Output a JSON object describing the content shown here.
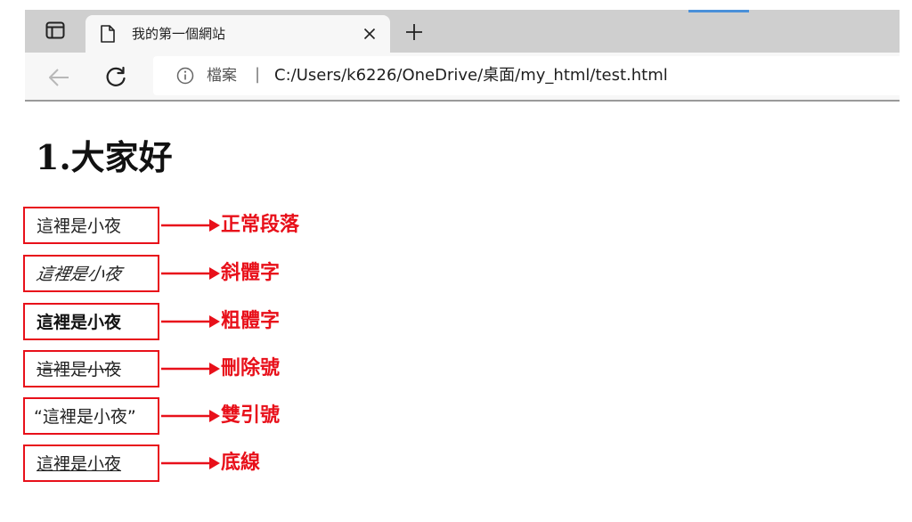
{
  "browser": {
    "tab": {
      "title": "我的第一個網站"
    },
    "address": {
      "site_label": "檔案",
      "divider": "|",
      "url": "C:/Users/k6226/OneDrive/桌面/my_html/test.html"
    },
    "icons": [
      "tab-actions-icon",
      "document-icon",
      "close-icon",
      "plus-icon",
      "back-arrow-icon",
      "reload-icon",
      "info-icon"
    ]
  },
  "page": {
    "heading": "1.大家好",
    "examples": [
      {
        "sample": "這裡是小夜",
        "label": "正常段落",
        "style": "normal"
      },
      {
        "sample": "這裡是小夜",
        "label": "斜體字",
        "style": "italic"
      },
      {
        "sample": "這裡是小夜",
        "label": "粗體字",
        "style": "bold"
      },
      {
        "sample": "這裡是小夜",
        "label": "刪除號",
        "style": "strikethrough"
      },
      {
        "sample": "“這裡是小夜”",
        "label": "雙引號",
        "style": "quoted"
      },
      {
        "sample": "這裡是小夜",
        "label": "底線",
        "style": "underline"
      }
    ]
  },
  "colors": {
    "annotation": "#e8101a",
    "tabstrip": "#cfcfcf",
    "toolbar": "#f7f7f7",
    "tab_accent": "#4a90d9"
  }
}
